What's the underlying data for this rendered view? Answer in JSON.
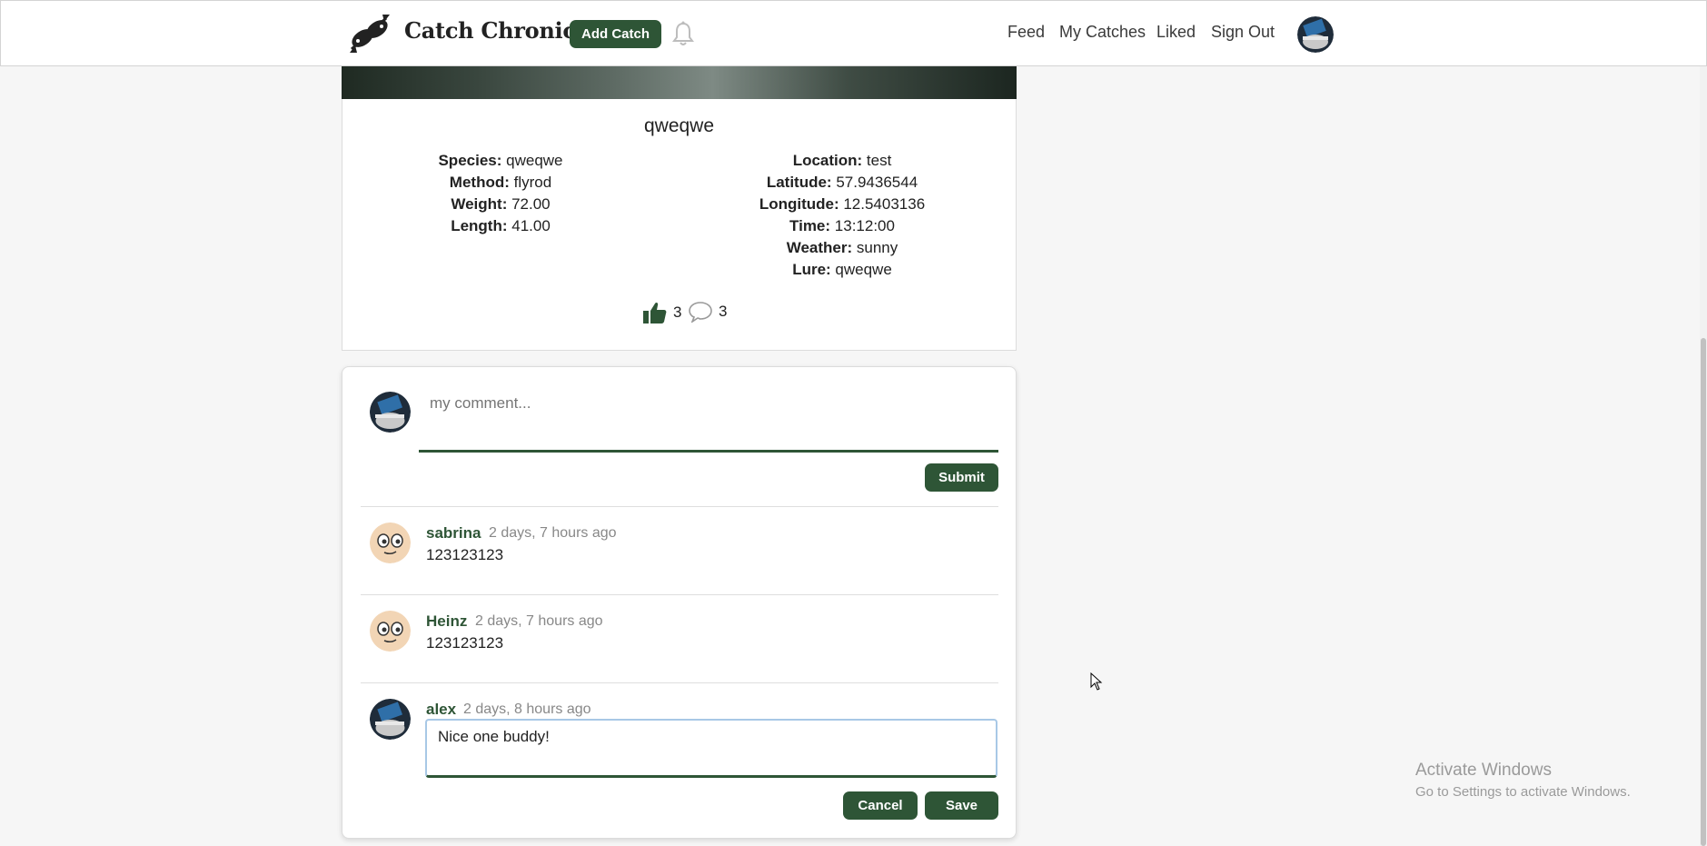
{
  "nav": {
    "brand": "Catch Chronicle",
    "add_catch_label": "Add Catch",
    "links": [
      "Feed",
      "My Catches",
      "Liked",
      "Sign Out"
    ]
  },
  "catch": {
    "title": "qweqwe",
    "left": [
      {
        "label": "Species:",
        "value": " qweqwe"
      },
      {
        "label": "Method:",
        "value": " flyrod"
      },
      {
        "label": "Weight:",
        "value": " 72.00"
      },
      {
        "label": "Length:",
        "value": " 41.00"
      }
    ],
    "right": [
      {
        "label": "Location:",
        "value": " test"
      },
      {
        "label": "Latitude:",
        "value": " 57.9436544"
      },
      {
        "label": "Longitude:",
        "value": " 12.5403136"
      },
      {
        "label": "Time:",
        "value": " 13:12:00"
      },
      {
        "label": "Weather:",
        "value": " sunny"
      },
      {
        "label": "Lure:",
        "value": " qweqwe"
      }
    ],
    "likes": "3",
    "comments_count": "3"
  },
  "comment_form": {
    "placeholder": "my comment...",
    "submit_label": "Submit"
  },
  "comments": [
    {
      "author": "sabrina",
      "time": "2 days, 7 hours ago",
      "text": "123123123"
    },
    {
      "author": "Heinz",
      "time": "2 days, 7 hours ago",
      "text": "123123123"
    },
    {
      "author": "alex",
      "time": "2 days, 8 hours ago",
      "edit_value": "Nice one buddy!"
    }
  ],
  "edit": {
    "cancel_label": "Cancel",
    "save_label": "Save"
  },
  "watermark": {
    "title": "Activate Windows",
    "subtitle": "Go to Settings to activate Windows."
  },
  "colors": {
    "accent": "#2e5536",
    "page_bg": "#f6f6f6"
  }
}
